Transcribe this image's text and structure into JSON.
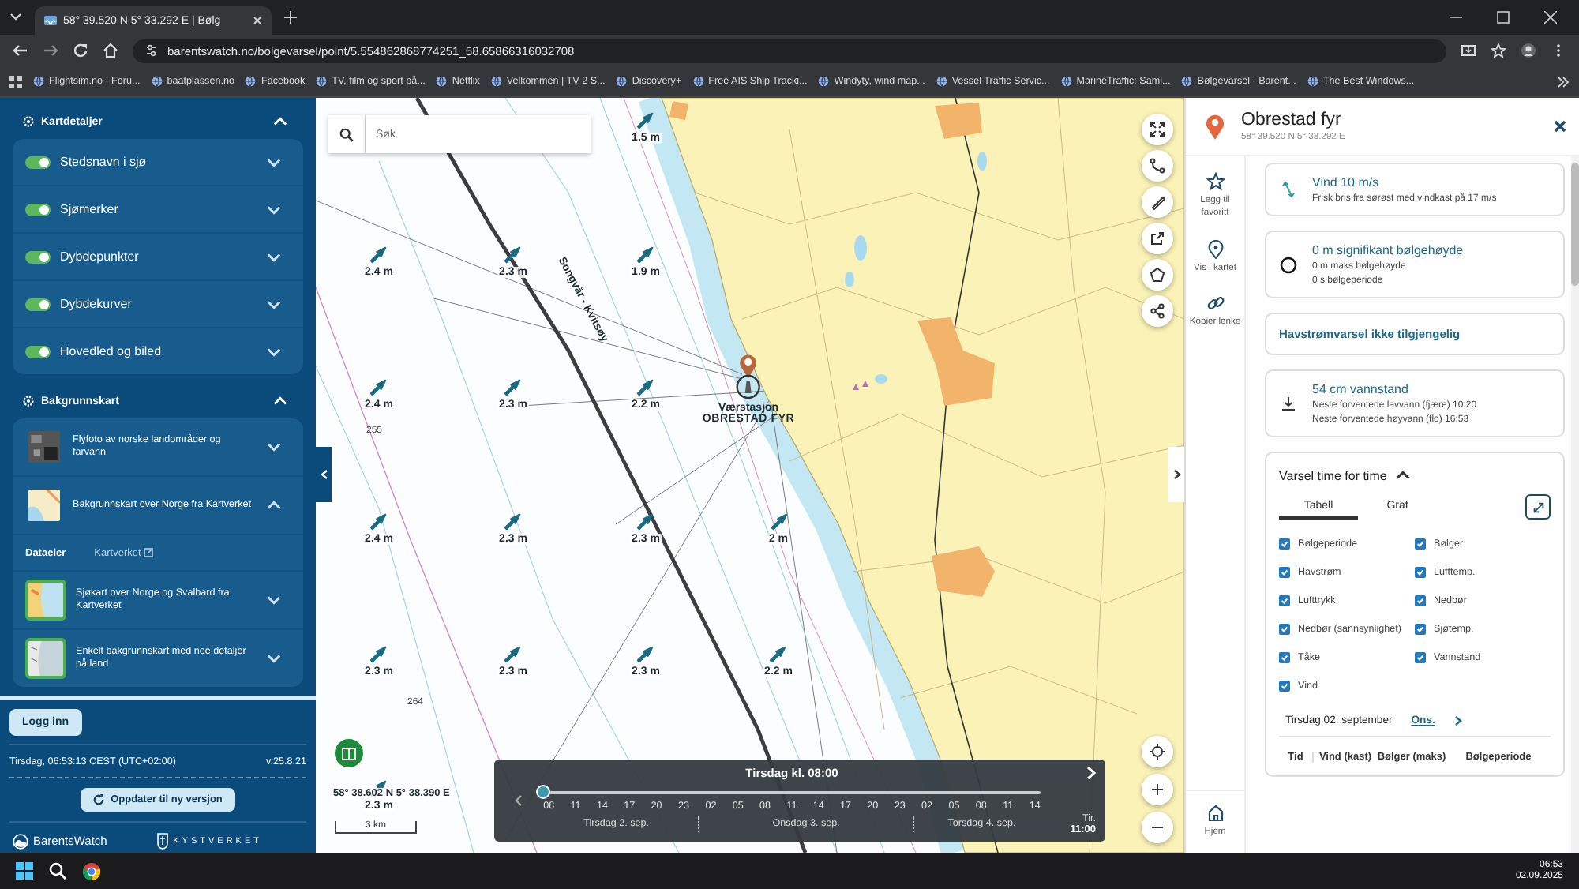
{
  "browser": {
    "tab_title": "58° 39.520 N 5° 33.292 E | Bølg",
    "url": "barentswatch.no/bolgevarsel/point/5.554862868774251_58.65866316032708",
    "bookmarks": [
      "Flightsim.no - Foru...",
      "baatplassen.no",
      "Facebook",
      "TV, film og sport på...",
      "Netflix",
      "Velkommen | TV 2 S...",
      "Discovery+",
      "Free AIS Ship Tracki...",
      "Windyty, wind map...",
      "Vessel Traffic Servic...",
      "MarineTraffic: Saml...",
      "Bølgevarsel - Barent...",
      "The Best Windows..."
    ]
  },
  "sidebar": {
    "sections": [
      {
        "title": "Kartdetaljer",
        "expanded": true,
        "kind": "toggles",
        "items": [
          {
            "label": "Stedsnavn i sjø",
            "on": true,
            "expanded": false
          },
          {
            "label": "Sjømerker",
            "on": true,
            "expanded": false
          },
          {
            "label": "Dybdepunkter",
            "on": true,
            "expanded": false
          },
          {
            "label": "Dybdekurver",
            "on": true,
            "expanded": false
          },
          {
            "label": "Hovedled og biled",
            "on": true,
            "expanded": false
          }
        ]
      },
      {
        "title": "Bakgrunnskart",
        "expanded": true,
        "kind": "basemaps",
        "items": [
          {
            "label": "Flyfoto av norske landområder og farvann",
            "kind": "photo",
            "selected": false,
            "expanded": false
          },
          {
            "label": "Bakgrunnskart over Norge fra Kartverket",
            "kind": "topo",
            "selected": false,
            "expanded": true,
            "details": {
              "label": "Dataeier",
              "link": "Kartverket"
            }
          },
          {
            "label": "Sjøkart over Norge og Svalbard fra Kartverket",
            "kind": "chart",
            "selected": true,
            "expanded": false
          },
          {
            "label": "Enkelt bakgrunnskart med noe detaljer på land",
            "kind": "simple",
            "selected": true,
            "expanded": false
          }
        ]
      }
    ],
    "login_button": "Logg inn",
    "clock": "Tirsdag, 06:53:13 CEST (UTC+02:00)",
    "version": "v.25.8.21",
    "update_button": "Oppdater til ny versjon",
    "logos": [
      {
        "kind": "barentswatch",
        "label": "BarentsWatch"
      },
      {
        "kind": "kystverket",
        "label": "KYSTVERKET"
      }
    ]
  },
  "map": {
    "search": {
      "placeholder": "Søk"
    },
    "wave_markers": [
      "1.5 m",
      "2.4 m",
      "2.3 m",
      "1.9 m",
      "2.4 m",
      "2.3 m",
      "2.2 m",
      "2.4 m",
      "2.3 m",
      "2.3 m",
      "2 m",
      "2.3 m",
      "2.3 m",
      "2.3 m",
      "2.2 m",
      "2.3 m"
    ],
    "place_labels": [
      {
        "kind": "route",
        "text": "Songvår - Kvitsøy"
      },
      {
        "kind": "depth",
        "text": "255"
      },
      {
        "kind": "depth",
        "text": "264"
      }
    ],
    "station": {
      "title": "Værstasjon",
      "name": "OBRESTAD FYR"
    },
    "coordinate": "58° 38.602 N 5° 38.390 E",
    "scale": "3 km",
    "timeline": {
      "title": "Tirsdag kl. 08:00",
      "level": 0,
      "days": [
        {
          "label": "Tirsdag 2. sep.",
          "hours": [
            "08",
            "11",
            "14",
            "17",
            "20",
            "23"
          ]
        },
        {
          "label": "Onsdag 3. sep.",
          "hours": [
            "02",
            "05",
            "08",
            "11",
            "14",
            "17",
            "20",
            "23"
          ]
        },
        {
          "label": "Torsdag 4. sep.",
          "hours": [
            "02",
            "05",
            "08",
            "11",
            "14"
          ]
        }
      ],
      "end_day": "Tir.",
      "end_time": "11:00"
    }
  },
  "info": {
    "title": "Obrestad fyr",
    "coords": "58° 39.520 N 5° 33.292 E",
    "actions": [
      {
        "kind": "favorite",
        "label": "Legg til favoritt"
      },
      {
        "kind": "show",
        "label": "Vis i kartet"
      },
      {
        "kind": "link",
        "label": "Kopier lenke"
      }
    ],
    "home": "Hjem",
    "cards": [
      {
        "kind": "wind",
        "title": "Vind 10 m/s",
        "lines": [
          "Frisk bris fra sørøst med vindkast på 17 m/s"
        ]
      },
      {
        "kind": "wave",
        "title": "0 m signifikant bølgehøyde",
        "lines": [
          "0 m maks bølgehøyde",
          "0 s bølgeperiode"
        ]
      },
      {
        "kind": "notice",
        "title": "Havstrømvarsel ikke tilgjengelig"
      },
      {
        "kind": "tide",
        "title": "54 cm vannstand",
        "lines": [
          "Neste forventede lavvann (fjære) 10:20",
          "Neste forventede høyvann (flo) 16:53"
        ]
      }
    ],
    "forecast": {
      "title": "Varsel time for time",
      "expanded": true,
      "tabs": [
        {
          "label": "Tabell",
          "selected": true
        },
        {
          "label": "Graf",
          "selected": false
        }
      ],
      "options": [
        {
          "label": "Bølgeperiode",
          "checked": true
        },
        {
          "label": "Bølger",
          "checked": true
        },
        {
          "label": "Havstrøm",
          "checked": true
        },
        {
          "label": "Lufttemp.",
          "checked": true
        },
        {
          "label": "Lufttrykk",
          "checked": true
        },
        {
          "label": "Nedbør",
          "checked": true
        },
        {
          "label": "Nedbør (sannsynlighet)",
          "checked": true
        },
        {
          "label": "Sjøtemp.",
          "checked": true
        },
        {
          "label": "Tåke",
          "checked": true
        },
        {
          "label": "Vannstand",
          "checked": true
        },
        {
          "label": "Vind",
          "checked": true
        }
      ],
      "day": "Tirsdag 02. september",
      "next_day": "Ons.",
      "table": {
        "columns": [
          "Tid",
          "Vind (kast)",
          "Bølger (maks)",
          "Bølgeperiode"
        ]
      }
    }
  },
  "taskbar": {
    "time": "06:53",
    "date": "02.09.2025"
  }
}
